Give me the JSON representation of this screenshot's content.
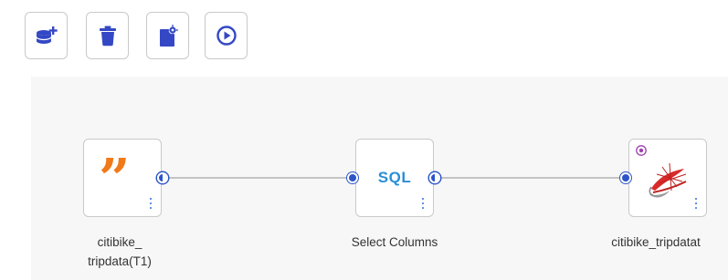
{
  "toolbar": {
    "buttons": [
      {
        "name": "add-datasource",
        "icon": "database-plus-icon"
      },
      {
        "name": "delete",
        "icon": "trash-icon"
      },
      {
        "name": "settings",
        "icon": "file-gear-icon"
      },
      {
        "name": "run",
        "icon": "play-circle-icon"
      }
    ]
  },
  "flow": {
    "nodes": [
      {
        "id": "source",
        "label": "citibike_\ntripdata(T1)",
        "icon": "quote-icon"
      },
      {
        "id": "transform",
        "label": "Select Columns",
        "icon": "sql-icon",
        "icon_text": "SQL"
      },
      {
        "id": "target",
        "label": "citibike_tripdatat",
        "icon": "sql-server-icon"
      }
    ],
    "edges": [
      {
        "from": "source",
        "to": "transform"
      },
      {
        "from": "transform",
        "to": "target"
      }
    ]
  },
  "colors": {
    "accent": "#2d55c8",
    "quote": "#f07a1a",
    "sql": "#2a8fd6",
    "toolbar_icon": "#3448c5"
  }
}
